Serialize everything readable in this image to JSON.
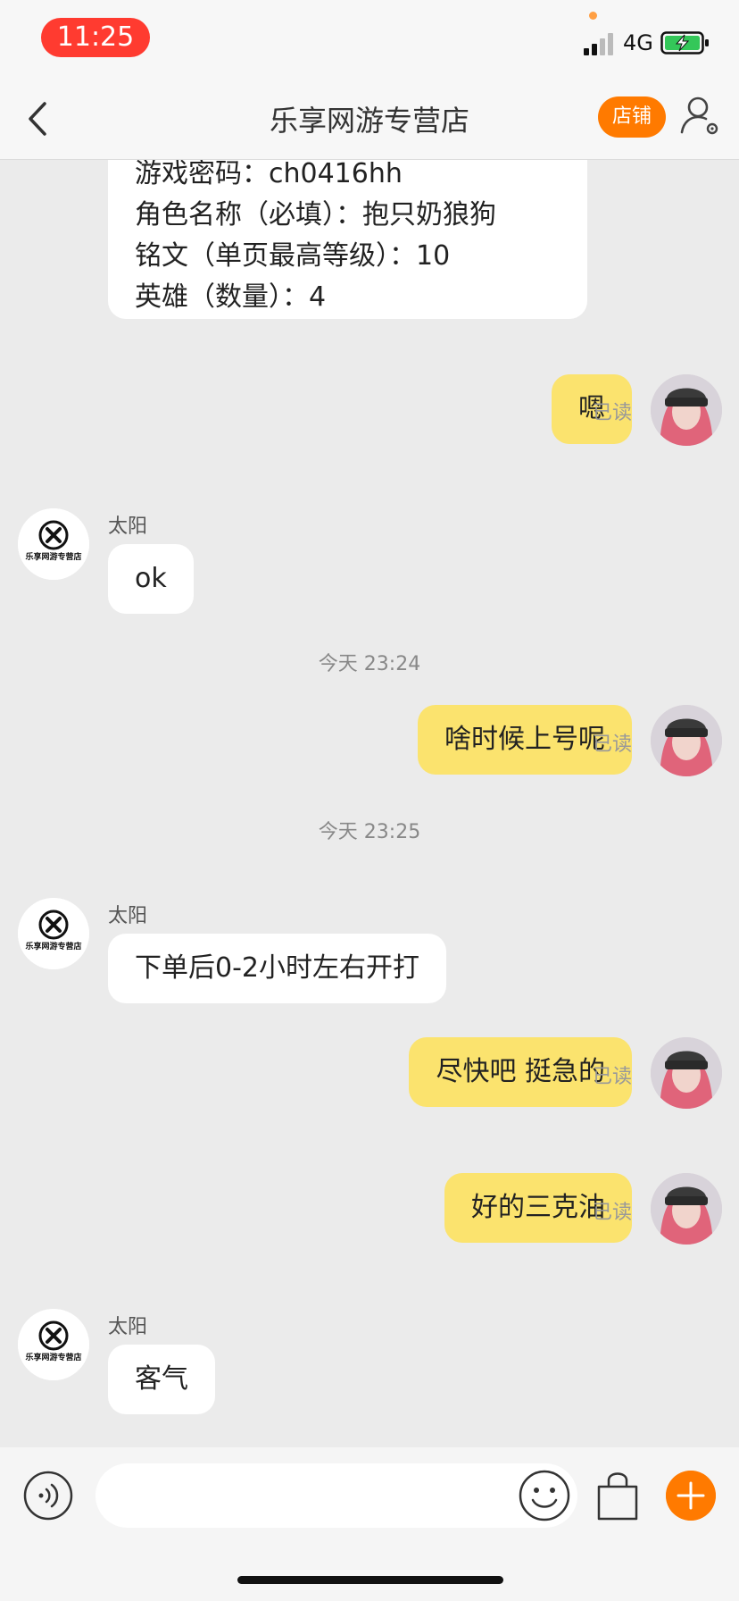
{
  "status_bar": {
    "time": "11:25",
    "network": "4G",
    "icons": [
      "signal-icon",
      "battery-charging-icon"
    ]
  },
  "nav": {
    "title": "乐享网游专营店",
    "shop_button_label": "店铺",
    "icons": [
      "back-chevron-icon",
      "profile-settings-icon"
    ]
  },
  "form_card": {
    "lines": [
      "游戏密码：ch0416hh",
      "角色名称（必填）：抱只奶狼狗",
      "铭文（单页最高等级）：10",
      "英雄（数量）：4"
    ]
  },
  "messages": [
    {
      "side": "right",
      "text": "嗯",
      "status": "已读"
    },
    {
      "side": "left",
      "sender": "太阳",
      "text": "ok"
    },
    {
      "side": "divider",
      "text": "今天 23:24"
    },
    {
      "side": "right",
      "text": "啥时候上号呢",
      "status": "已读"
    },
    {
      "side": "divider",
      "text": "今天 23:25"
    },
    {
      "side": "left",
      "sender": "太阳",
      "text": "下单后0-2小时左右开打"
    },
    {
      "side": "right",
      "text": "尽快吧 挺急的",
      "status": "已读"
    },
    {
      "side": "right",
      "text": "好的三克油",
      "status": "已读"
    },
    {
      "side": "left",
      "sender": "太阳",
      "text": "客气"
    }
  ],
  "shop_avatar_text": "乐享网游专营店",
  "input_bar": {
    "placeholder": "",
    "icons": [
      "voice-icon",
      "emoji-icon",
      "shopping-bag-icon",
      "plus-icon"
    ]
  },
  "colors": {
    "accent": "#ff7a00",
    "bubble_self": "#fbe36e",
    "bubble_other": "#ffffff",
    "background": "#ebebeb",
    "status_time_bg": "#ff3b30"
  }
}
